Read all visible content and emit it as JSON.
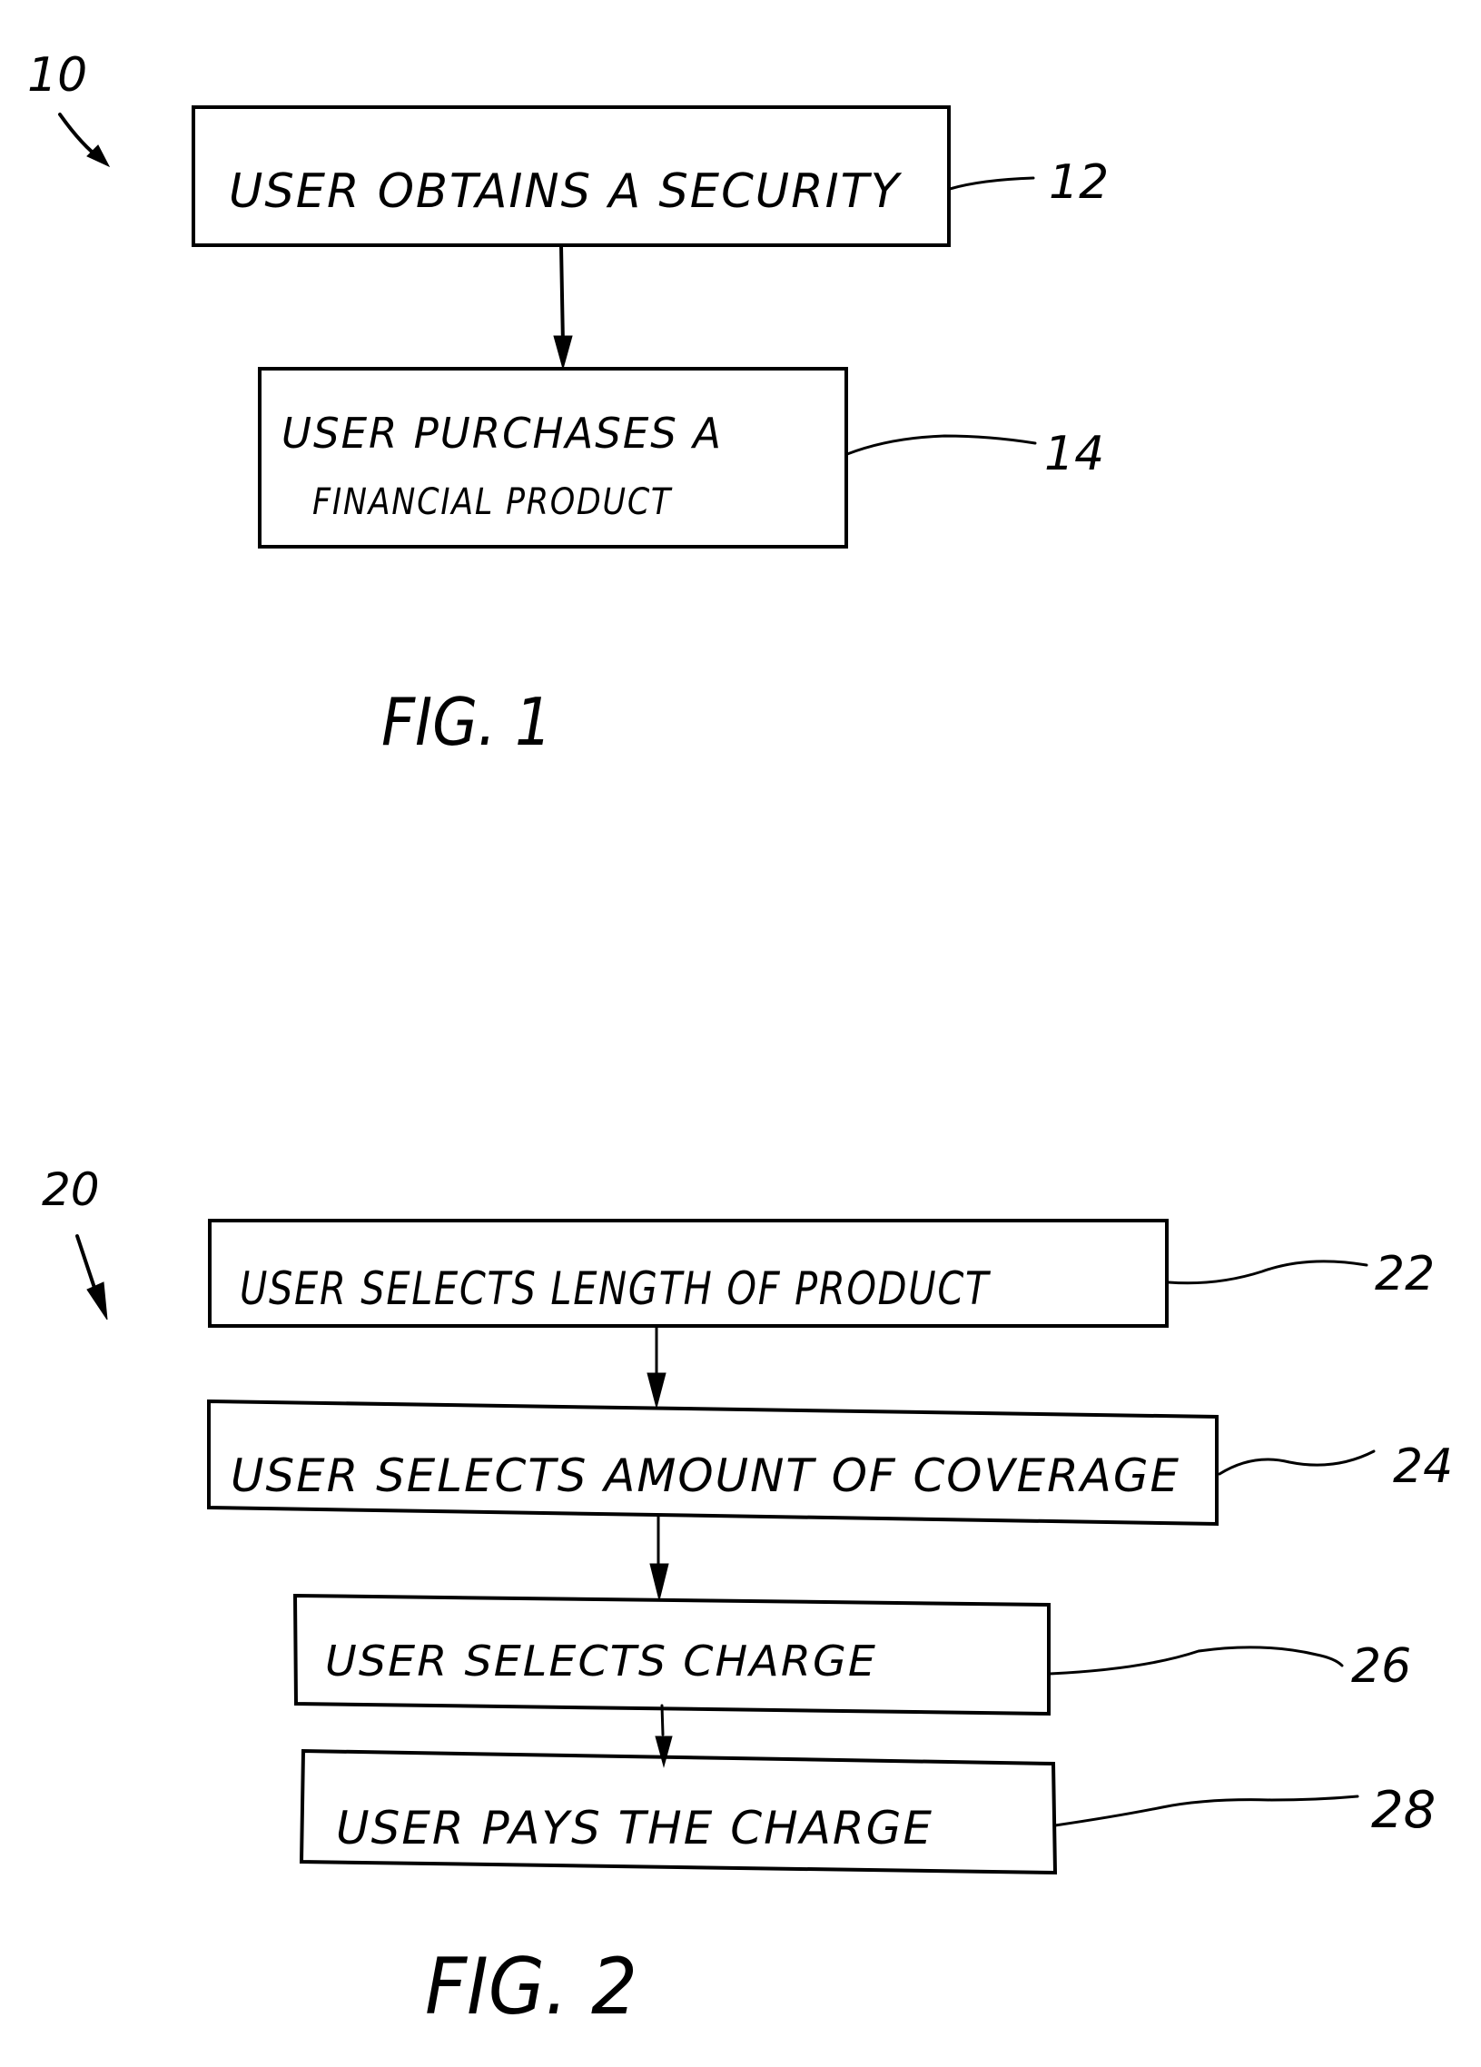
{
  "figure1": {
    "ref": "10",
    "caption": "FIG. 1",
    "steps": [
      {
        "ref": "12",
        "lines": [
          "USER OBTAINS A SECURITY"
        ]
      },
      {
        "ref": "14",
        "lines": [
          "USER PURCHASES A",
          "FINANCIAL PRODUCT"
        ]
      }
    ]
  },
  "figure2": {
    "ref": "20",
    "caption": "FIG. 2",
    "steps": [
      {
        "ref": "22",
        "lines": [
          "USER SELECTS LENGTH OF PRODUCT"
        ]
      },
      {
        "ref": "24",
        "lines": [
          "USER SELECTS AMOUNT OF COVERAGE"
        ]
      },
      {
        "ref": "26",
        "lines": [
          "USER SELECTS CHARGE"
        ]
      },
      {
        "ref": "28",
        "lines": [
          "USER PAYS THE CHARGE"
        ]
      }
    ]
  }
}
